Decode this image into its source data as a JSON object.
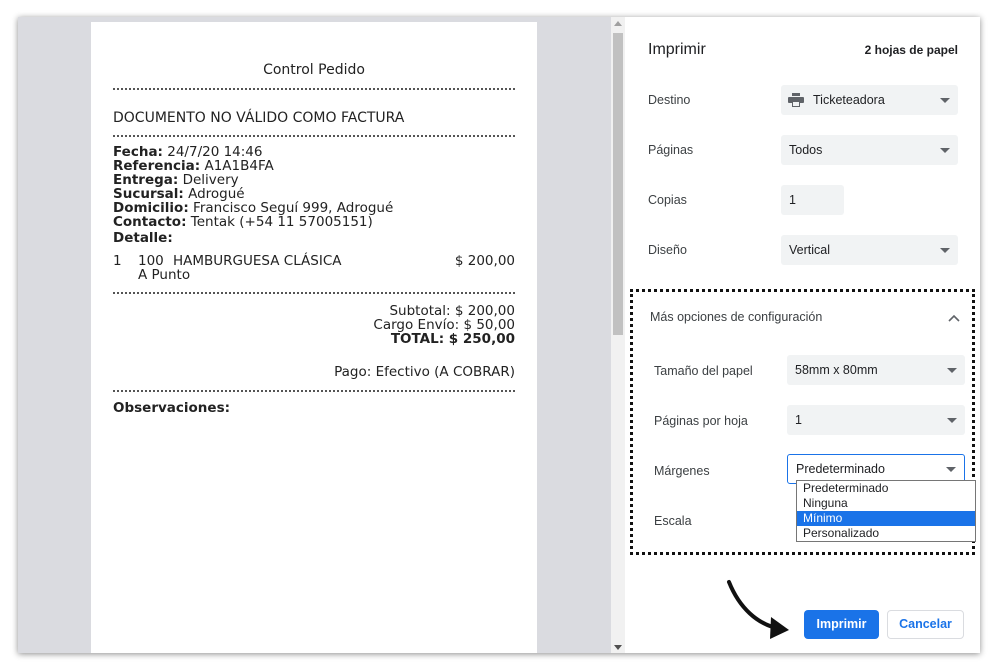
{
  "preview": {
    "title": "Control Pedido",
    "notice": "DOCUMENTO NO VÁLIDO COMO FACTURA",
    "fields": [
      {
        "label": "Fecha:",
        "value": "24/7/20 14:46"
      },
      {
        "label": "Referencia:",
        "value": "A1A1B4FA"
      },
      {
        "label": "Entrega:",
        "value": "Delivery"
      },
      {
        "label": "Sucursal:",
        "value": "Adrogué"
      },
      {
        "label": "Domicilio:",
        "value": "Francisco Seguí 999, Adrogué"
      },
      {
        "label": "Contacto:",
        "value": "Tentak (+54 11 57005151)"
      }
    ],
    "detail_heading": "Detalle:",
    "item": {
      "qty": "1",
      "code": "100",
      "name": "HAMBURGUESA CLÁSICA",
      "note": "A Punto",
      "price": "$ 200,00"
    },
    "subtotal": "Subtotal:  $ 200,00",
    "shipping": "Cargo Envío:  $ 50,00",
    "total": "TOTAL:  $ 250,00",
    "payment": "Pago: Efectivo (A COBRAR)",
    "observations": "Observaciones:"
  },
  "panel": {
    "title": "Imprimir",
    "sheets": "2 hojas de papel",
    "destination": {
      "label": "Destino",
      "value": "Ticketeadora"
    },
    "pages": {
      "label": "Páginas",
      "value": "Todos"
    },
    "copies": {
      "label": "Copias",
      "value": "1"
    },
    "layout": {
      "label": "Diseño",
      "value": "Vertical"
    },
    "more_options": "Más opciones de configuración",
    "paper_size": {
      "label": "Tamaño del papel",
      "value": "58mm x 80mm"
    },
    "pages_per_sheet": {
      "label": "Páginas por hoja",
      "value": "1"
    },
    "margins": {
      "label": "Márgenes",
      "value": "Predeterminado",
      "options": [
        "Predeterminado",
        "Ninguna",
        "Mínimo",
        "Personalizado"
      ],
      "highlighted": "Mínimo"
    },
    "scale": {
      "label": "Escala"
    },
    "print_button": "Imprimir",
    "cancel_button": "Cancelar"
  },
  "colors": {
    "accent": "#1a73e8",
    "preview_bg": "#dadbe0"
  },
  "icons": [
    "printer-icon",
    "chevron-down-icon",
    "chevron-up-icon",
    "curved-arrow-icon"
  ]
}
